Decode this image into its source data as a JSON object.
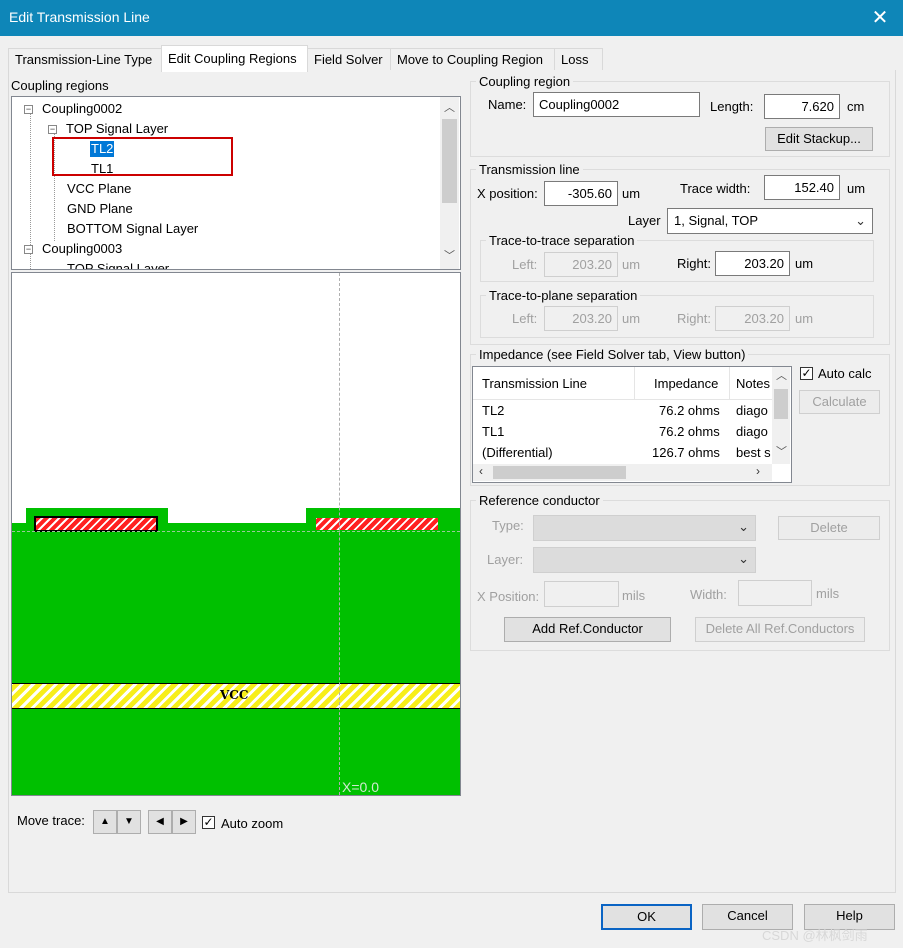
{
  "window": {
    "title": "Edit Transmission Line",
    "close_glyph": "✕"
  },
  "tabs": [
    "Transmission-Line Type",
    "Edit Coupling Regions",
    "Field Solver",
    "Move to Coupling Region",
    "Loss"
  ],
  "active_tab": "Edit Coupling Regions",
  "tree": {
    "heading": "Coupling regions",
    "items": [
      "Coupling0002",
      "TOP Signal Layer",
      "TL2",
      "TL1",
      "VCC Plane",
      "GND Plane",
      "BOTTOM Signal Layer",
      "Coupling0003",
      "TOP Signal Layer"
    ],
    "selected": "TL2",
    "highlight_color": "#cc0000"
  },
  "canvas": {
    "plane_label": "VCC",
    "coordinate_readout": "X=0.0",
    "colors": {
      "dielectric": "#00c000",
      "plane": "#f7ee1a",
      "trace": "#ff2020"
    }
  },
  "move_trace": {
    "label": "Move trace:",
    "up": "▲",
    "down": "▼",
    "left": "◀",
    "right": "▶",
    "auto_zoom_label": "Auto zoom",
    "auto_zoom_checked": true
  },
  "coupling_region": {
    "group_label": "Coupling region",
    "name_label": "Name:",
    "name_value": "Coupling0002",
    "length_label": "Length:",
    "length_value": "7.620",
    "length_unit": "cm",
    "edit_stackup_button": "Edit Stackup..."
  },
  "transmission_line": {
    "group_label": "Transmission line",
    "x_position_label": "X position:",
    "x_position_value": "-305.60",
    "x_position_unit": "um",
    "trace_width_label": "Trace width:",
    "trace_width_value": "152.40",
    "trace_width_unit": "um",
    "layer_label": "Layer",
    "layer_value": "1, Signal, TOP",
    "trace_sep": {
      "group_label": "Trace-to-trace separation",
      "left_label": "Left:",
      "left_value": "203.20",
      "left_unit": "um",
      "right_label": "Right:",
      "right_value": "203.20",
      "right_unit": "um"
    },
    "plane_sep": {
      "group_label": "Trace-to-plane separation",
      "left_label": "Left:",
      "left_value": "203.20",
      "left_unit": "um",
      "right_label": "Right:",
      "right_value": "203.20",
      "right_unit": "um"
    }
  },
  "impedance": {
    "group_label": "Impedance (see Field Solver tab, View button)",
    "columns": [
      "Transmission Line",
      "Impedance",
      "Notes"
    ],
    "rows": [
      {
        "line": "TL2",
        "impedance": "76.2 ohms",
        "notes": "diago"
      },
      {
        "line": "TL1",
        "impedance": "76.2 ohms",
        "notes": "diago"
      },
      {
        "line": "(Differential)",
        "impedance": "126.7 ohms",
        "notes": "best s"
      }
    ],
    "auto_calc_label": "Auto calc",
    "auto_calc_checked": true,
    "calculate_button": "Calculate"
  },
  "reference_conductor": {
    "group_label": "Reference conductor",
    "type_label": "Type:",
    "delete_button": "Delete",
    "layer_label": "Layer:",
    "x_position_label": "X Position:",
    "x_position_unit": "mils",
    "width_label": "Width:",
    "width_unit": "mils",
    "add_button": "Add Ref.Conductor",
    "delete_all_button": "Delete All Ref.Conductors"
  },
  "footer": {
    "ok_button": "OK",
    "cancel_button": "Cancel",
    "help_button": "Help",
    "watermark": "CSDN @林枫剑雨"
  }
}
